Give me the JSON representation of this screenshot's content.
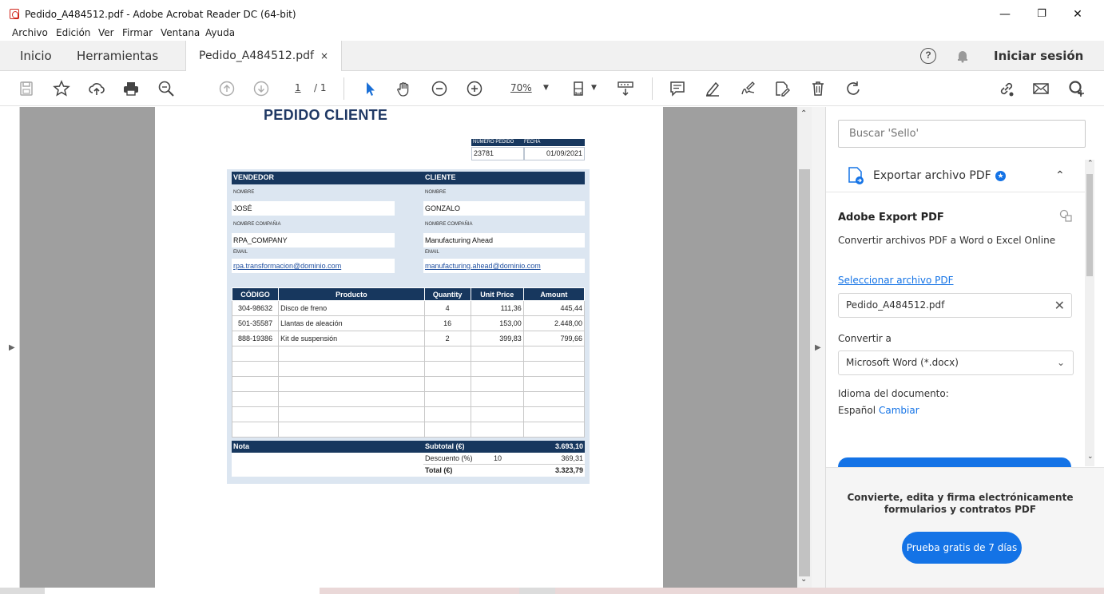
{
  "window": {
    "title": "Pedido_A484512.pdf - Adobe Acrobat Reader DC (64-bit)",
    "minimize": "—",
    "restore": "❐",
    "close": "✕"
  },
  "menu": [
    "Archivo",
    "Edición",
    "Ver",
    "Firmar",
    "Ventana",
    "Ayuda"
  ],
  "tabs": {
    "home": "Inicio",
    "tools": "Herramientas",
    "document": "Pedido_A484512.pdf",
    "close_glyph": "×",
    "signin": "Iniciar sesión"
  },
  "toolbar": {
    "page_current": "1",
    "page_total": "/ 1",
    "zoom": "70%"
  },
  "document": {
    "title": "PEDIDO CLIENTE",
    "order_header": {
      "number_label": "NÚMERO PEDIDO",
      "date_label": "FECHA",
      "number": "23781",
      "date": "01/09/2021"
    },
    "vendor": {
      "heading": "VENDEDOR",
      "name_label": "NOMBRE",
      "name": "JOSÉ",
      "company_label": "NOMBRE COMPAÑIA",
      "company": "RPA_COMPANY",
      "email_label": "EMAIL",
      "email": "rpa.transformacion@dominio.com"
    },
    "client": {
      "heading": "CLIENTE",
      "name_label": "NOMBRE",
      "name": "GONZALO",
      "company_label": "NOMBRE COMPAÑIA",
      "company": "Manufacturing Ahead",
      "email_label": "EMAIL",
      "email": "manufacturing.ahead@dominio.com"
    },
    "items_headers": [
      "CÓDIGO",
      "Producto",
      "Quantity",
      "Unit Price",
      "Amount"
    ],
    "items": [
      [
        "304-98632",
        "Disco de freno",
        "4",
        "111,36",
        "445,44"
      ],
      [
        "501-35587",
        "Llantas de aleación",
        "16",
        "153,00",
        "2.448,00"
      ],
      [
        "888-19386",
        "Kit de suspensión",
        "2",
        "399,83",
        "799,66"
      ],
      [
        "",
        "",
        "",
        "",
        ""
      ],
      [
        "",
        "",
        "",
        "",
        ""
      ],
      [
        "",
        "",
        "",
        "",
        ""
      ],
      [
        "",
        "",
        "",
        "",
        ""
      ],
      [
        "",
        "",
        "",
        "",
        ""
      ],
      [
        "",
        "",
        "",
        "",
        ""
      ]
    ],
    "note_label": "Nota",
    "subtotal_label": "Subtotal (€)",
    "subtotal": "3.693,10",
    "discount_label": "Descuento (%)",
    "discount_pct": "10",
    "discount": "369,31",
    "total_label": "Total (€)",
    "total": "3.323,79"
  },
  "rightpanel": {
    "search_placeholder": "Buscar 'Sello'",
    "export_title": "Exportar archivo PDF",
    "adobe_export": "Adobe Export PDF",
    "convert_desc": "Convertir archivos PDF a Word o Excel Online",
    "select_file": "Seleccionar archivo PDF",
    "file_name": "Pedido_A484512.pdf",
    "convert_to": "Convertir a",
    "format": "Microsoft Word (*.docx)",
    "language_label": "Idioma del documento:",
    "language": "Español",
    "change": "Cambiar",
    "promo": "Convierte, edita y firma electrónicamente formularios y contratos PDF",
    "trial_button": "Prueba gratis de 7 días"
  }
}
